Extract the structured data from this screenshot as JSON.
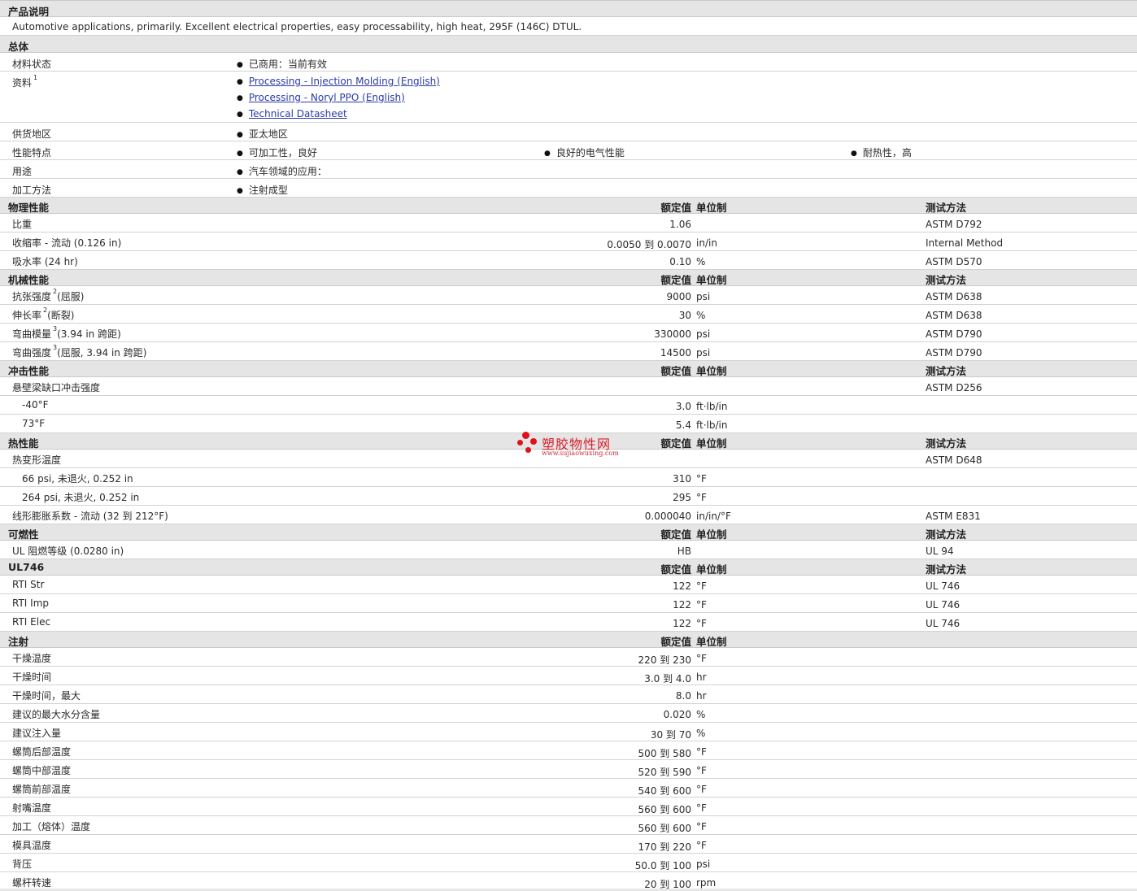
{
  "description": {
    "title": "产品说明",
    "text": "Automotive applications, primarily. Excellent electrical properties, easy processability, high heat, 295F (146C) DTUL."
  },
  "general": {
    "title": "总体",
    "rows": [
      {
        "label": "材料状态",
        "items": [
          "已商用：当前有效"
        ]
      },
      {
        "label": "资料",
        "sup": "1",
        "links": [
          "Processing - Injection Molding (English)",
          "Processing - Noryl PPO (English)",
          "Technical Datasheet"
        ]
      },
      {
        "label": "供货地区",
        "items": [
          "亚太地区"
        ]
      },
      {
        "label": "性能特点",
        "items": [
          "可加工性，良好",
          "良好的电气性能",
          "耐热性，高"
        ]
      },
      {
        "label": "用途",
        "items": [
          "汽车领域的应用："
        ]
      },
      {
        "label": "加工方法",
        "items": [
          "注射成型"
        ]
      }
    ]
  },
  "columns": {
    "value": "额定值",
    "unit": "单位制",
    "test": "测试方法"
  },
  "sections": [
    {
      "title": "物理性能",
      "rows": [
        {
          "label": "比重",
          "value": "1.06",
          "unit": "",
          "test": "ASTM D792"
        },
        {
          "label": "收缩率 - 流动 (0.126 in)",
          "value": "0.0050 到 0.0070",
          "unit": "in/in",
          "test": "Internal Method"
        },
        {
          "label": "吸水率 (24 hr)",
          "value": "0.10",
          "unit": "%",
          "test": "ASTM D570"
        }
      ]
    },
    {
      "title": "机械性能",
      "rows": [
        {
          "label": "抗张强度",
          "sup": "2",
          "suffix": "(屈服)",
          "value": "9000",
          "unit": "psi",
          "test": "ASTM D638"
        },
        {
          "label": "伸长率",
          "sup": "2",
          "suffix": "(断裂)",
          "value": "30",
          "unit": "%",
          "test": "ASTM D638"
        },
        {
          "label": "弯曲模量",
          "sup": "3",
          "suffix": "(3.94 in 跨距)",
          "value": "330000",
          "unit": "psi",
          "test": "ASTM D790"
        },
        {
          "label": "弯曲强度",
          "sup": "3",
          "suffix": "(屈服, 3.94 in 跨距)",
          "value": "14500",
          "unit": "psi",
          "test": "ASTM D790"
        }
      ]
    },
    {
      "title": "冲击性能",
      "rows": [
        {
          "label": "悬壁梁缺口冲击强度",
          "value": "",
          "unit": "",
          "test": "ASTM D256"
        },
        {
          "label": "-40°F",
          "indent": true,
          "value": "3.0",
          "unit": "ft·lb/in",
          "test": ""
        },
        {
          "label": "73°F",
          "indent": true,
          "value": "5.4",
          "unit": "ft·lb/in",
          "test": ""
        }
      ]
    },
    {
      "title": "热性能",
      "rows": [
        {
          "label": "热变形温度",
          "value": "",
          "unit": "",
          "test": "ASTM D648"
        },
        {
          "label": "66 psi, 未退火, 0.252 in",
          "indent": true,
          "value": "310",
          "unit": "°F",
          "test": ""
        },
        {
          "label": "264 psi, 未退火, 0.252 in",
          "indent": true,
          "value": "295",
          "unit": "°F",
          "test": ""
        },
        {
          "label": "线形膨胀系数 - 流动 (32 到 212°F)",
          "value": "0.000040",
          "unit": "in/in/°F",
          "test": "ASTM E831"
        }
      ]
    },
    {
      "title": "可燃性",
      "rows": [
        {
          "label": "UL 阻燃等级 (0.0280 in)",
          "value": "HB",
          "unit": "",
          "test": "UL 94"
        }
      ]
    },
    {
      "title": "UL746",
      "rows": [
        {
          "label": "RTI Str",
          "value": "122",
          "unit": "°F",
          "test": "UL 746"
        },
        {
          "label": "RTI Imp",
          "value": "122",
          "unit": "°F",
          "test": "UL 746"
        },
        {
          "label": "RTI Elec",
          "value": "122",
          "unit": "°F",
          "test": "UL 746"
        }
      ]
    },
    {
      "title": "注射",
      "noTest": true,
      "rows": [
        {
          "label": "干燥温度",
          "value": "220 到 230",
          "unit": "°F"
        },
        {
          "label": "干燥时间",
          "value": "3.0 到 4.0",
          "unit": "hr"
        },
        {
          "label": "干燥时间，最大",
          "value": "8.0",
          "unit": "hr"
        },
        {
          "label": "建议的最大水分含量",
          "value": "0.020",
          "unit": "%"
        },
        {
          "label": "建议注入量",
          "value": "30 到 70",
          "unit": "%"
        },
        {
          "label": "螺筒后部温度",
          "value": "500 到 580",
          "unit": "°F"
        },
        {
          "label": "螺筒中部温度",
          "value": "520 到 590",
          "unit": "°F"
        },
        {
          "label": "螺筒前部温度",
          "value": "540 到 600",
          "unit": "°F"
        },
        {
          "label": "射嘴温度",
          "value": "560 到 600",
          "unit": "°F"
        },
        {
          "label": "加工（熔体）温度",
          "value": "560 到 600",
          "unit": "°F"
        },
        {
          "label": "模具温度",
          "value": "170 到 220",
          "unit": "°F"
        },
        {
          "label": "背压",
          "value": "50.0 到 100",
          "unit": "psi"
        },
        {
          "label": "螺杆转速",
          "value": "20 到 100",
          "unit": "rpm"
        }
      ]
    }
  ],
  "watermark": {
    "name": "塑胶物性网",
    "url": "www.sujiaowuxing.com"
  }
}
